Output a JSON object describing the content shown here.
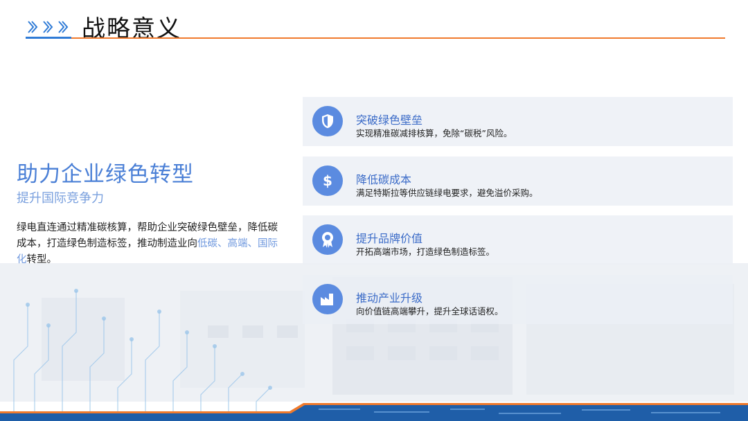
{
  "header": {
    "title": "战略意义"
  },
  "left": {
    "heading": "助力企业绿色转型",
    "subheading": "提升国际竞争力",
    "paragraph": {
      "part1": "绿电直连通过精准碳核算，帮助企业突破绿色壁垒，降低碳成本，打造绿色制造标签，推动制造业向",
      "highlight": "低碳、高端、国际化",
      "part2": "转型。"
    }
  },
  "cards": [
    {
      "icon": "shield-icon",
      "title": "突破绿色壁垒",
      "desc": "实现精准碳减排核算，免除“碳税”风险。"
    },
    {
      "icon": "dollar-icon",
      "title": "降低碳成本",
      "desc": "满足特斯拉等供应链绿电要求，避免溢价采购。"
    },
    {
      "icon": "award-icon",
      "title": "提升品牌价值",
      "desc": "开拓高端市场，打造绿色制造标签。"
    },
    {
      "icon": "factory-icon",
      "title": "推动产业升级",
      "desc": "向价值链高端攀升，提升全球话语权。"
    }
  ],
  "colors": {
    "accent_blue": "#4a7fd6",
    "icon_blue": "#5b8be0",
    "rule_orange": "#f07a2c",
    "footer_blue": "#1f5ea8"
  }
}
